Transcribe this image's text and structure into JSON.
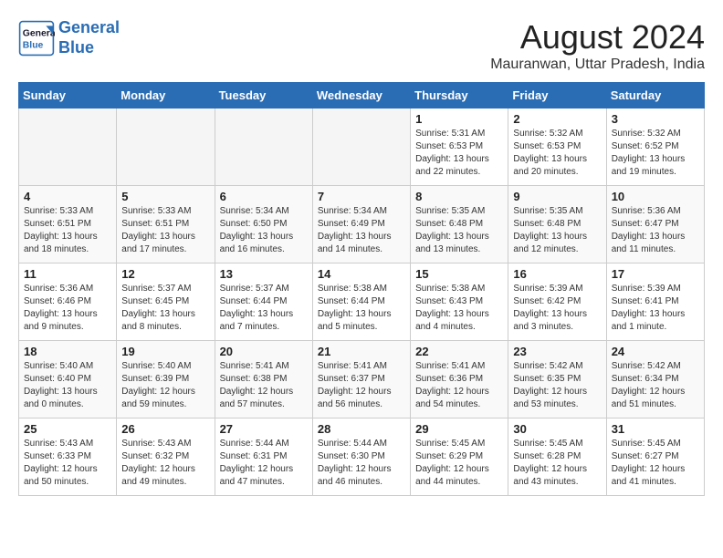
{
  "header": {
    "logo_line1": "General",
    "logo_line2": "Blue",
    "month_year": "August 2024",
    "location": "Mauranwan, Uttar Pradesh, India"
  },
  "weekdays": [
    "Sunday",
    "Monday",
    "Tuesday",
    "Wednesday",
    "Thursday",
    "Friday",
    "Saturday"
  ],
  "weeks": [
    [
      {
        "day": "",
        "info": ""
      },
      {
        "day": "",
        "info": ""
      },
      {
        "day": "",
        "info": ""
      },
      {
        "day": "",
        "info": ""
      },
      {
        "day": "1",
        "info": "Sunrise: 5:31 AM\nSunset: 6:53 PM\nDaylight: 13 hours\nand 22 minutes."
      },
      {
        "day": "2",
        "info": "Sunrise: 5:32 AM\nSunset: 6:53 PM\nDaylight: 13 hours\nand 20 minutes."
      },
      {
        "day": "3",
        "info": "Sunrise: 5:32 AM\nSunset: 6:52 PM\nDaylight: 13 hours\nand 19 minutes."
      }
    ],
    [
      {
        "day": "4",
        "info": "Sunrise: 5:33 AM\nSunset: 6:51 PM\nDaylight: 13 hours\nand 18 minutes."
      },
      {
        "day": "5",
        "info": "Sunrise: 5:33 AM\nSunset: 6:51 PM\nDaylight: 13 hours\nand 17 minutes."
      },
      {
        "day": "6",
        "info": "Sunrise: 5:34 AM\nSunset: 6:50 PM\nDaylight: 13 hours\nand 16 minutes."
      },
      {
        "day": "7",
        "info": "Sunrise: 5:34 AM\nSunset: 6:49 PM\nDaylight: 13 hours\nand 14 minutes."
      },
      {
        "day": "8",
        "info": "Sunrise: 5:35 AM\nSunset: 6:48 PM\nDaylight: 13 hours\nand 13 minutes."
      },
      {
        "day": "9",
        "info": "Sunrise: 5:35 AM\nSunset: 6:48 PM\nDaylight: 13 hours\nand 12 minutes."
      },
      {
        "day": "10",
        "info": "Sunrise: 5:36 AM\nSunset: 6:47 PM\nDaylight: 13 hours\nand 11 minutes."
      }
    ],
    [
      {
        "day": "11",
        "info": "Sunrise: 5:36 AM\nSunset: 6:46 PM\nDaylight: 13 hours\nand 9 minutes."
      },
      {
        "day": "12",
        "info": "Sunrise: 5:37 AM\nSunset: 6:45 PM\nDaylight: 13 hours\nand 8 minutes."
      },
      {
        "day": "13",
        "info": "Sunrise: 5:37 AM\nSunset: 6:44 PM\nDaylight: 13 hours\nand 7 minutes."
      },
      {
        "day": "14",
        "info": "Sunrise: 5:38 AM\nSunset: 6:44 PM\nDaylight: 13 hours\nand 5 minutes."
      },
      {
        "day": "15",
        "info": "Sunrise: 5:38 AM\nSunset: 6:43 PM\nDaylight: 13 hours\nand 4 minutes."
      },
      {
        "day": "16",
        "info": "Sunrise: 5:39 AM\nSunset: 6:42 PM\nDaylight: 13 hours\nand 3 minutes."
      },
      {
        "day": "17",
        "info": "Sunrise: 5:39 AM\nSunset: 6:41 PM\nDaylight: 13 hours\nand 1 minute."
      }
    ],
    [
      {
        "day": "18",
        "info": "Sunrise: 5:40 AM\nSunset: 6:40 PM\nDaylight: 13 hours\nand 0 minutes."
      },
      {
        "day": "19",
        "info": "Sunrise: 5:40 AM\nSunset: 6:39 PM\nDaylight: 12 hours\nand 59 minutes."
      },
      {
        "day": "20",
        "info": "Sunrise: 5:41 AM\nSunset: 6:38 PM\nDaylight: 12 hours\nand 57 minutes."
      },
      {
        "day": "21",
        "info": "Sunrise: 5:41 AM\nSunset: 6:37 PM\nDaylight: 12 hours\nand 56 minutes."
      },
      {
        "day": "22",
        "info": "Sunrise: 5:41 AM\nSunset: 6:36 PM\nDaylight: 12 hours\nand 54 minutes."
      },
      {
        "day": "23",
        "info": "Sunrise: 5:42 AM\nSunset: 6:35 PM\nDaylight: 12 hours\nand 53 minutes."
      },
      {
        "day": "24",
        "info": "Sunrise: 5:42 AM\nSunset: 6:34 PM\nDaylight: 12 hours\nand 51 minutes."
      }
    ],
    [
      {
        "day": "25",
        "info": "Sunrise: 5:43 AM\nSunset: 6:33 PM\nDaylight: 12 hours\nand 50 minutes."
      },
      {
        "day": "26",
        "info": "Sunrise: 5:43 AM\nSunset: 6:32 PM\nDaylight: 12 hours\nand 49 minutes."
      },
      {
        "day": "27",
        "info": "Sunrise: 5:44 AM\nSunset: 6:31 PM\nDaylight: 12 hours\nand 47 minutes."
      },
      {
        "day": "28",
        "info": "Sunrise: 5:44 AM\nSunset: 6:30 PM\nDaylight: 12 hours\nand 46 minutes."
      },
      {
        "day": "29",
        "info": "Sunrise: 5:45 AM\nSunset: 6:29 PM\nDaylight: 12 hours\nand 44 minutes."
      },
      {
        "day": "30",
        "info": "Sunrise: 5:45 AM\nSunset: 6:28 PM\nDaylight: 12 hours\nand 43 minutes."
      },
      {
        "day": "31",
        "info": "Sunrise: 5:45 AM\nSunset: 6:27 PM\nDaylight: 12 hours\nand 41 minutes."
      }
    ]
  ]
}
